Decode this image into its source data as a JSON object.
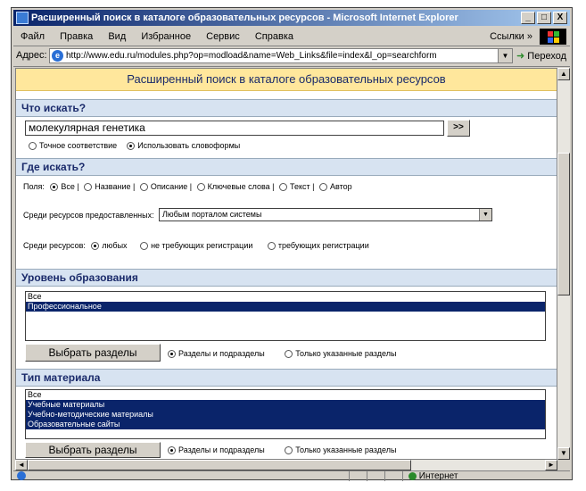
{
  "window": {
    "title": "Расширенный поиск в каталоге образовательных ресурсов - Microsoft Internet Explorer",
    "btn_min": "_",
    "btn_max": "□",
    "btn_close": "X"
  },
  "menu": {
    "items": [
      "Файл",
      "Правка",
      "Вид",
      "Избранное",
      "Сервис",
      "Справка"
    ],
    "links": "Ссылки »"
  },
  "address": {
    "label": "Адрес:",
    "url": "http://www.edu.ru/modules.php?op=modload&name=Web_Links&file=index&l_op=searchform",
    "go": "Переход"
  },
  "page": {
    "header": "Расширенный поиск в каталоге образовательных ресурсов",
    "what": {
      "title": "Что искать?",
      "query": "молекулярная генетика",
      "submit": ">>",
      "opt_exact": "Точное соответствие",
      "opt_forms": "Использовать словоформы",
      "selected": "forms"
    },
    "where": {
      "title": "Где искать?",
      "fields_label": "Поля:",
      "fields": [
        "Все",
        "Название",
        "Описание",
        "Ключевые слова",
        "Текст",
        "Автор"
      ],
      "fields_selected": 0,
      "provided_label": "Среди ресурсов предоставленных:",
      "provided_value": "Любым порталом системы",
      "resources_label": "Среди ресурсов:",
      "resources": [
        "любых",
        "не требующих регистрации",
        "требующих регистрации"
      ],
      "resources_selected": 0
    },
    "level": {
      "title": "Уровень образования",
      "items": [
        {
          "label": "Все",
          "selected": false
        },
        {
          "label": "Профессиональное",
          "selected": true
        }
      ],
      "button": "Выбрать разделы",
      "opt_sub": "Разделы и подразделы",
      "opt_only": "Только указанные разделы"
    },
    "material": {
      "title": "Тип материала",
      "items": [
        {
          "label": "Все",
          "selected": false
        },
        {
          "label": "Учебные материалы",
          "selected": true
        },
        {
          "label": "Учебно-методические материалы",
          "selected": true
        },
        {
          "label": "Образовательные сайты",
          "selected": true
        }
      ],
      "button": "Выбрать разделы",
      "opt_sub": "Разделы и подразделы",
      "opt_only": "Только указанные разделы"
    }
  },
  "status": {
    "zone": "Интернет"
  }
}
